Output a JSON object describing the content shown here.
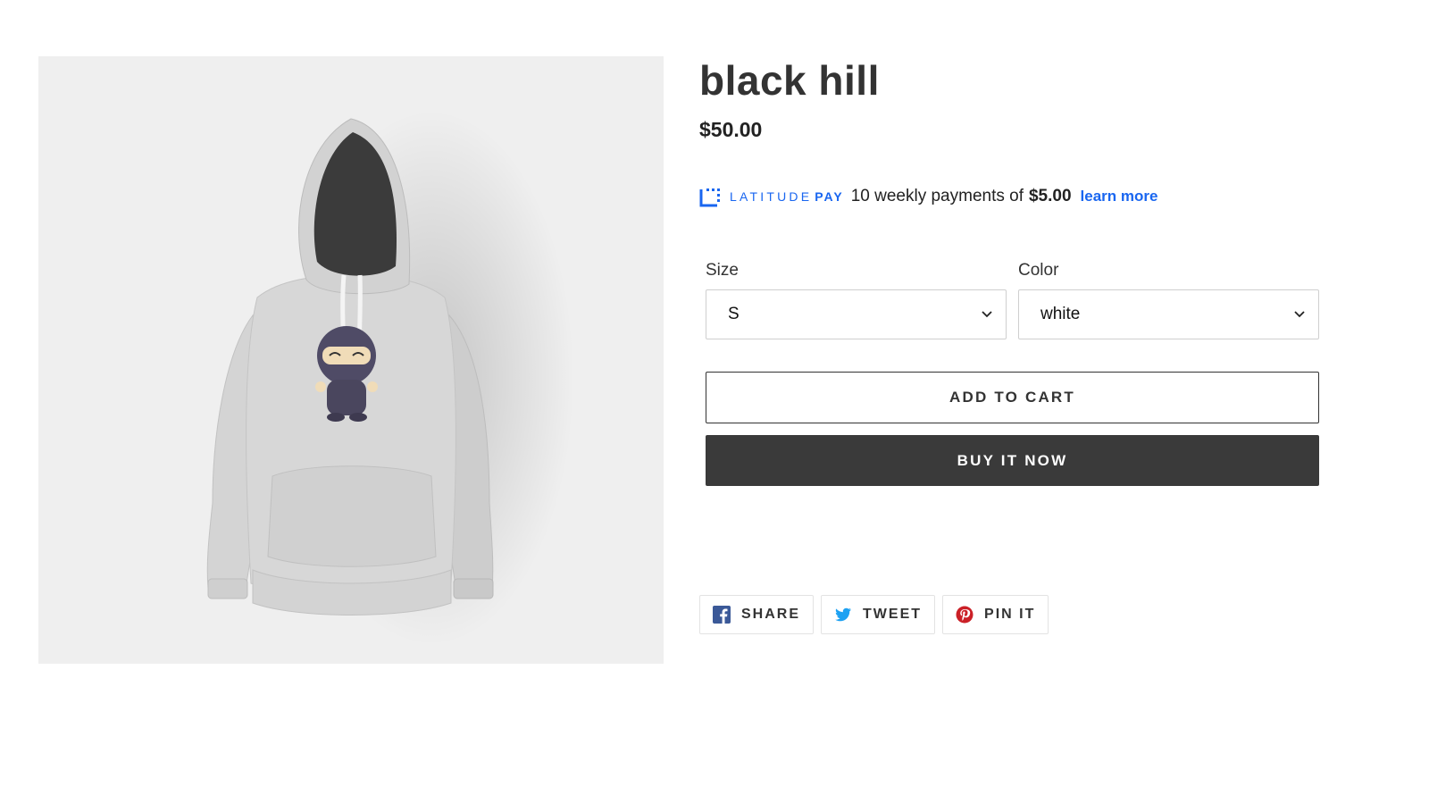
{
  "product": {
    "title": "black hill",
    "price": "$50.00",
    "image": "ninja-hoodie"
  },
  "latitude_pay": {
    "brand_word1": "LATITUDE",
    "brand_word2": "PAY",
    "text": "10 weekly payments of",
    "amount": "$5.00",
    "link": "learn more",
    "color": "#1966f0"
  },
  "options": {
    "size": {
      "label": "Size",
      "value": "S"
    },
    "color": {
      "label": "Color",
      "value": "white"
    }
  },
  "buttons": {
    "add_to_cart": "ADD TO CART",
    "buy_now": "BUY IT NOW"
  },
  "share": {
    "facebook": "SHARE",
    "twitter": "TWEET",
    "pinterest": "PIN IT"
  }
}
